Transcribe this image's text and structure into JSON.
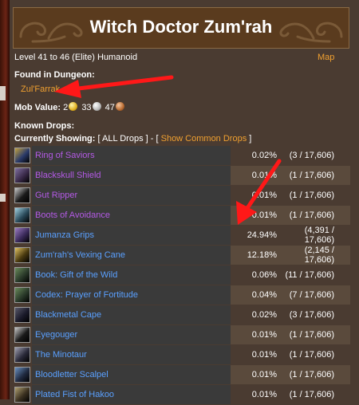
{
  "header": {
    "title": "Witch Doctor Zum'rah"
  },
  "info": {
    "level_text": "Level 41 to 46 (Elite) Humanoid",
    "map_label": "Map",
    "found_label": "Found in Dungeon:",
    "dungeon": "Zul'Farrak",
    "mob_value_label": "Mob Value:",
    "mob_value": {
      "gold": "2",
      "silver": "33",
      "copper": "47"
    }
  },
  "drops_section": {
    "known_label": "Known Drops:",
    "currently_showing_label": "Currently Showing:",
    "all_drops": "[ ALL Drops ]",
    "separator": " - [",
    "show_common": "Show Common Drops",
    "close_bracket": "]"
  },
  "drops": [
    {
      "name": "Ring of Saviors",
      "quality": "epic",
      "icon": "ring-icon",
      "pct": "0.02%",
      "count": "(3 / 17,606)"
    },
    {
      "name": "Blackskull Shield",
      "quality": "epic",
      "icon": "shield-icon",
      "pct": "0.01%",
      "count": "(1 / 17,606)"
    },
    {
      "name": "Gut Ripper",
      "quality": "epic",
      "icon": "dagger-icon",
      "pct": "0.01%",
      "count": "(1 / 17,606)"
    },
    {
      "name": "Boots of Avoidance",
      "quality": "epic",
      "icon": "boots-icon",
      "pct": "0.01%",
      "count": "(1 / 17,606)"
    },
    {
      "name": "Jumanza Grips",
      "quality": "rare",
      "icon": "gloves-icon",
      "pct": "24.94%",
      "count": "(4,391 / 17,606)"
    },
    {
      "name": "Zum'rah's Vexing Cane",
      "quality": "rare",
      "icon": "staff-icon",
      "pct": "12.18%",
      "count": "(2,145 / 17,606)"
    },
    {
      "name": "Book: Gift of the Wild",
      "quality": "rare",
      "icon": "book-icon",
      "pct": "0.06%",
      "count": "(11 / 17,606)"
    },
    {
      "name": "Codex: Prayer of Fortitude",
      "quality": "rare",
      "icon": "book-icon",
      "pct": "0.04%",
      "count": "(7 / 17,606)"
    },
    {
      "name": "Blackmetal Cape",
      "quality": "rare",
      "icon": "cape-icon",
      "pct": "0.02%",
      "count": "(3 / 17,606)"
    },
    {
      "name": "Eyegouger",
      "quality": "rare",
      "icon": "dagger-icon",
      "pct": "0.01%",
      "count": "(1 / 17,606)"
    },
    {
      "name": "The Minotaur",
      "quality": "rare",
      "icon": "axe-icon",
      "pct": "0.01%",
      "count": "(1 / 17,606)"
    },
    {
      "name": "Bloodletter Scalpel",
      "quality": "rare",
      "icon": "knife-icon",
      "pct": "0.01%",
      "count": "(1 / 17,606)"
    },
    {
      "name": "Plated Fist of Hakoo",
      "quality": "rare",
      "icon": "fist-icon",
      "pct": "0.01%",
      "count": "(1 / 17,606)"
    }
  ],
  "colors": {
    "epic": "#b45ae6",
    "rare": "#5aa0ff",
    "link": "#f0a030",
    "arrow": "#ff1818"
  }
}
